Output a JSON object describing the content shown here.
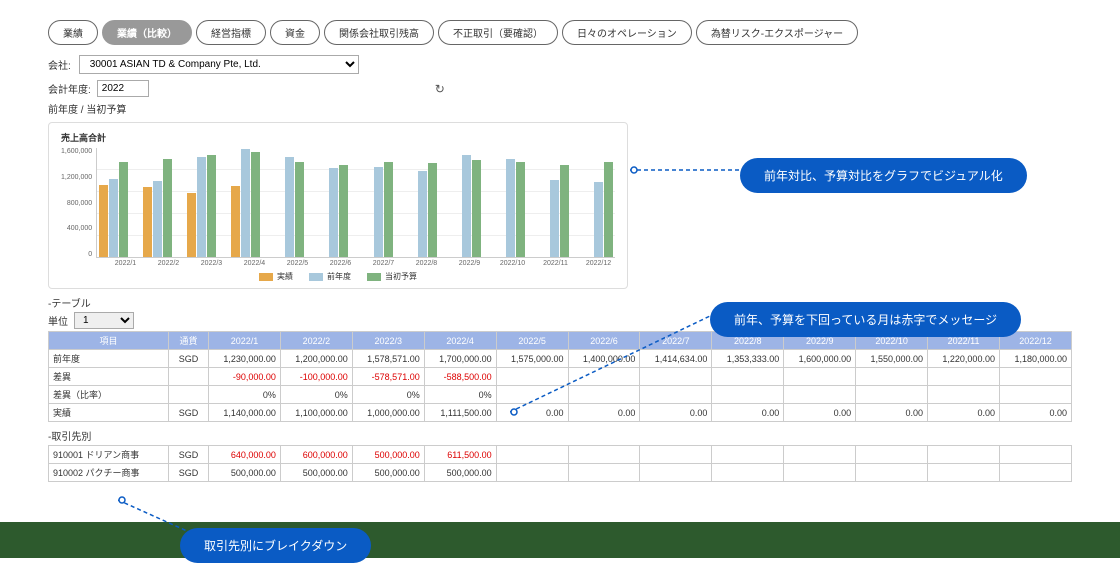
{
  "tabs": [
    "業績",
    "業績（比較）",
    "経営指標",
    "資金",
    "関係会社取引残高",
    "不正取引（要確認）",
    "日々のオペレーション",
    "為替リスク-エクスポージャー"
  ],
  "active_tab": 1,
  "company_label": "会社:",
  "company_value": "30001 ASIAN TD & Company Pte, Ltd.",
  "fy_label": "会計年度:",
  "fy_value": "2022",
  "sub_header": "前年度   /   当初予算",
  "chart_title": "売上高合計",
  "y_ticks": [
    "1,600,000",
    "1,200,000",
    "800,000",
    "400,000",
    "0"
  ],
  "months": [
    "2022/1",
    "2022/2",
    "2022/3",
    "2022/4",
    "2022/5",
    "2022/6",
    "2022/7",
    "2022/8",
    "2022/9",
    "2022/10",
    "2022/11",
    "2022/12"
  ],
  "legend": {
    "orange": "実績",
    "blue": "前年度",
    "green": "当初予算"
  },
  "table_section": "-テーブル",
  "unit_label": "単位",
  "unit_value": "1",
  "headers": [
    "項目",
    "通貨",
    "2022/1",
    "2022/2",
    "2022/3",
    "2022/4",
    "2022/5",
    "2022/6",
    "2022/7",
    "2022/8",
    "2022/9",
    "2022/10",
    "2022/11",
    "2022/12"
  ],
  "rows": {
    "prev_year": {
      "label": "前年度",
      "cur": "SGD",
      "v": [
        "1,230,000.00",
        "1,200,000.00",
        "1,578,571.00",
        "1,700,000.00",
        "1,575,000.00",
        "1,400,000.00",
        "1,414,634.00",
        "1,353,333.00",
        "1,600,000.00",
        "1,550,000.00",
        "1,220,000.00",
        "1,180,000.00"
      ]
    },
    "diff": {
      "label": "差異",
      "cur": "",
      "v": [
        "-90,000.00",
        "-100,000.00",
        "-578,571.00",
        "-588,500.00",
        "",
        "",
        "",
        "",
        "",
        "",
        "",
        ""
      ]
    },
    "diff_pct": {
      "label": "差異（比率）",
      "cur": "",
      "v": [
        "0%",
        "0%",
        "0%",
        "0%",
        "",
        "",
        "",
        "",
        "",
        "",
        "",
        ""
      ]
    },
    "actual": {
      "label": "実績",
      "cur": "SGD",
      "v": [
        "1,140,000.00",
        "1,100,000.00",
        "1,000,000.00",
        "1,111,500.00",
        "0.00",
        "0.00",
        "0.00",
        "0.00",
        "0.00",
        "0.00",
        "0.00",
        "0.00"
      ]
    }
  },
  "vendor_section": "-取引先別",
  "vendors": {
    "v1": {
      "label": "910001 ドリアン商事",
      "cur": "SGD",
      "v": [
        "640,000.00",
        "600,000.00",
        "500,000.00",
        "611,500.00",
        "",
        "",
        "",
        "",
        "",
        "",
        "",
        ""
      ]
    },
    "v2": {
      "label": "910002 パクチー商事",
      "cur": "SGD",
      "v": [
        "500,000.00",
        "500,000.00",
        "500,000.00",
        "500,000.00",
        "",
        "",
        "",
        "",
        "",
        "",
        "",
        ""
      ]
    }
  },
  "callouts": {
    "c1": "前年対比、予算対比をグラフでビジュアル化",
    "c2": "前年、予算を下回っている月は赤字でメッセージ",
    "c3": "取引先別にブレイクダウン"
  },
  "chart_data": {
    "type": "bar",
    "title": "売上高合計",
    "ylabel": "",
    "ylim": [
      0,
      1700000
    ],
    "categories": [
      "2022/1",
      "2022/2",
      "2022/3",
      "2022/4",
      "2022/5",
      "2022/6",
      "2022/7",
      "2022/8",
      "2022/9",
      "2022/10",
      "2022/11",
      "2022/12"
    ],
    "series": [
      {
        "name": "実績",
        "values": [
          1140000,
          1100000,
          1000000,
          1111500,
          null,
          null,
          null,
          null,
          null,
          null,
          null,
          null
        ]
      },
      {
        "name": "前年度",
        "values": [
          1230000,
          1200000,
          1578571,
          1700000,
          1575000,
          1400000,
          1414634,
          1353333,
          1600000,
          1550000,
          1220000,
          1180000
        ]
      },
      {
        "name": "当初予算",
        "values": [
          1500000,
          1550000,
          1600000,
          1650000,
          1500000,
          1450000,
          1500000,
          1480000,
          1520000,
          1500000,
          1450000,
          1500000
        ]
      }
    ]
  }
}
